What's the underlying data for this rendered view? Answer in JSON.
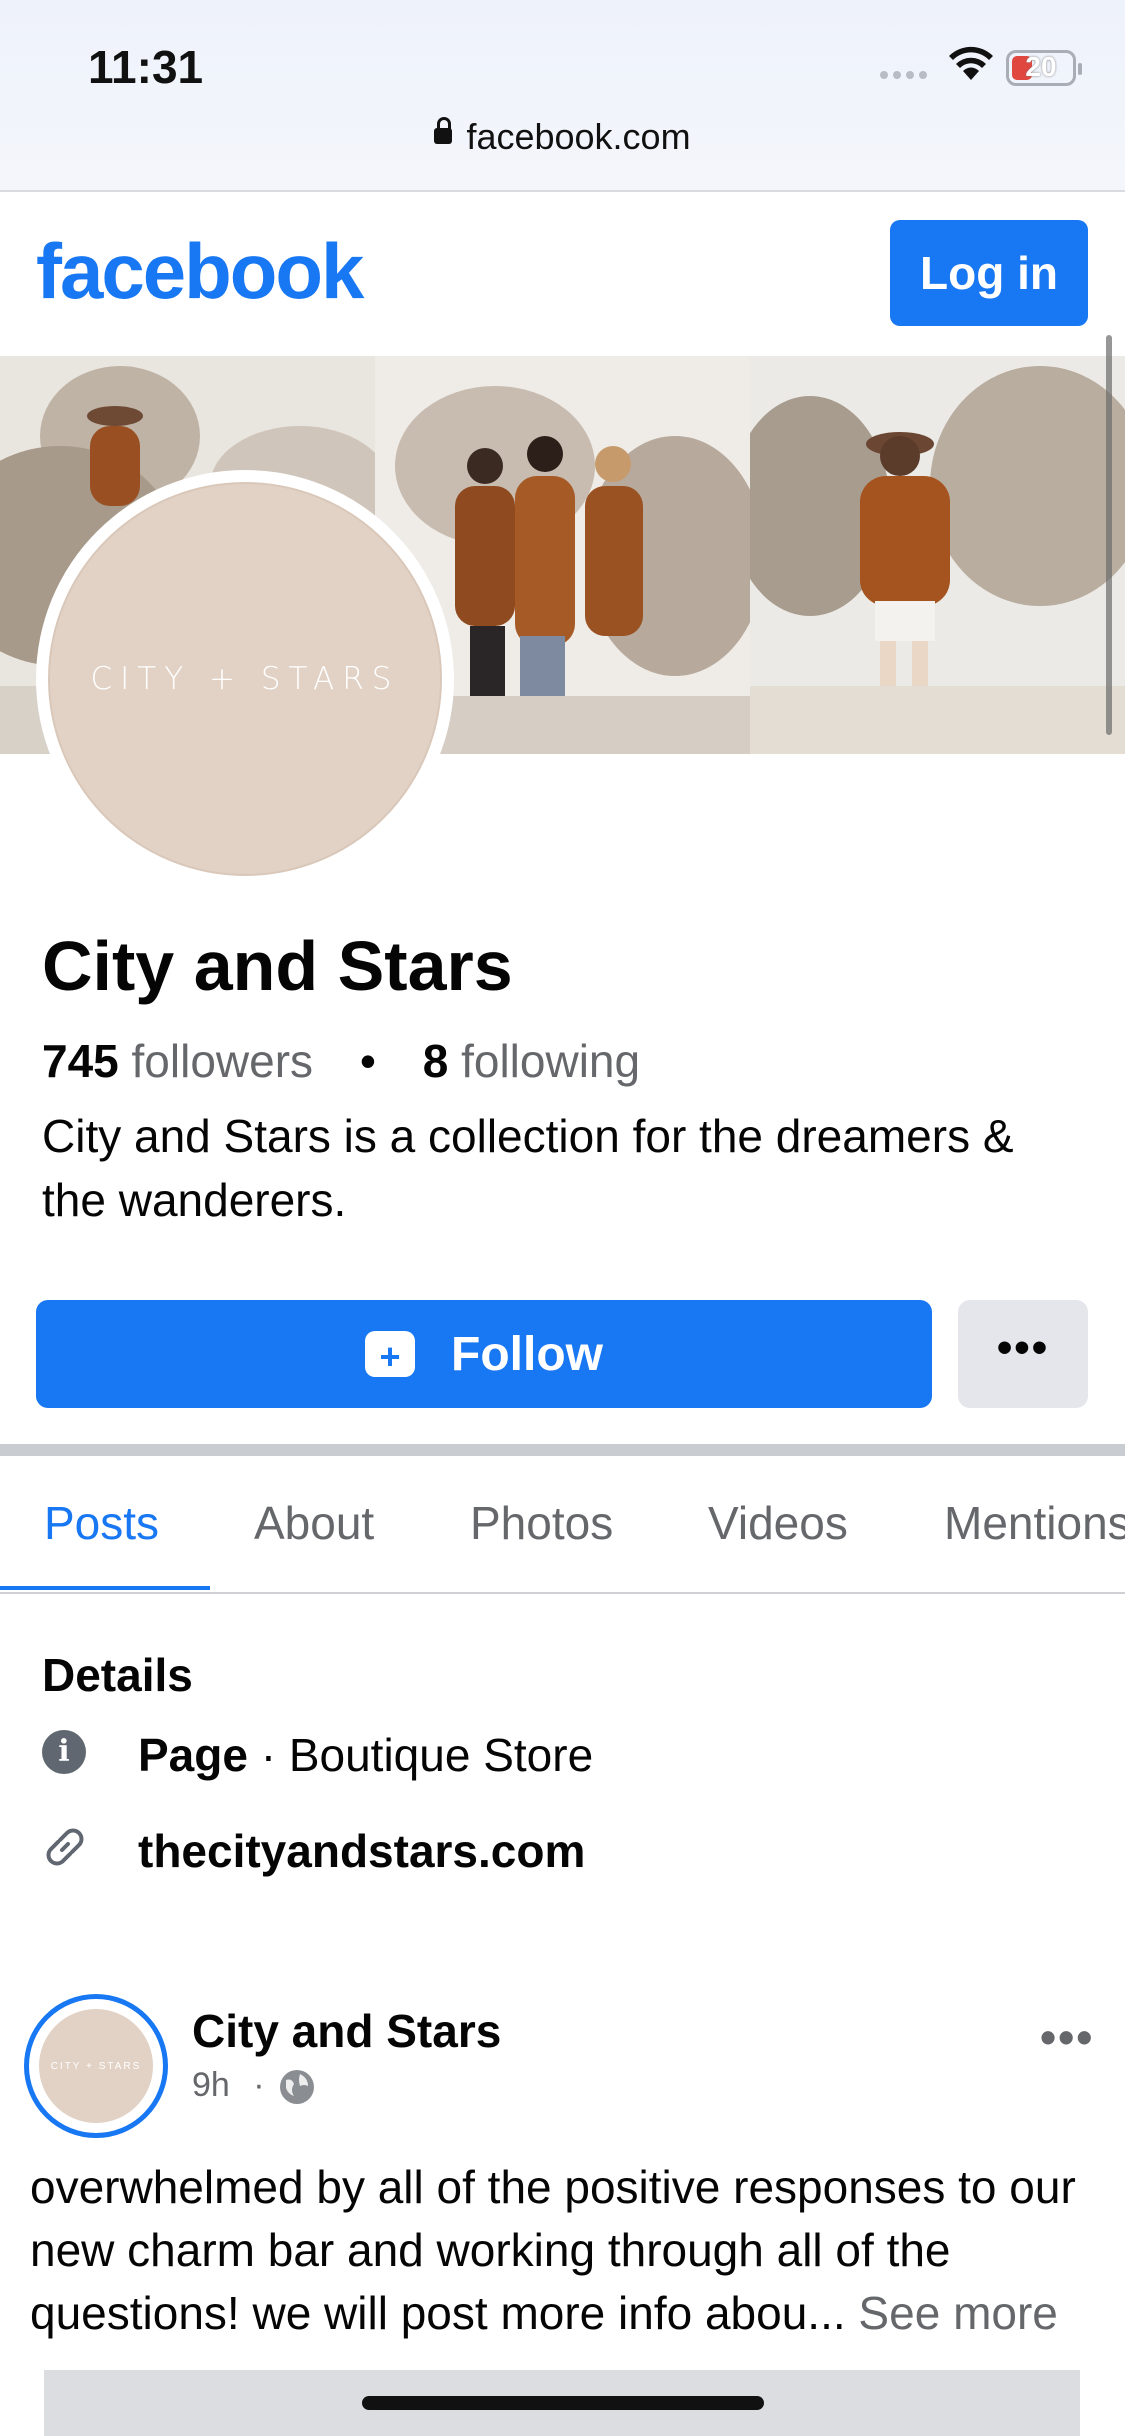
{
  "status_bar": {
    "time": "11:31",
    "battery": "20",
    "url": "facebook.com"
  },
  "header": {
    "logo": "facebook",
    "login_label": "Log in"
  },
  "profile": {
    "avatar_text": "CITY + STARS",
    "name": "City and Stars",
    "followers_count": "745",
    "followers_label": "followers",
    "following_count": "8",
    "following_label": "following",
    "separator": "•",
    "bio": "City and Stars is a collection for the dreamers & the wanderers.",
    "follow_label": "Follow",
    "more_label": "•••"
  },
  "tabs": [
    {
      "label": "Posts",
      "active": true
    },
    {
      "label": "About"
    },
    {
      "label": "Photos"
    },
    {
      "label": "Videos"
    },
    {
      "label": "Mentions"
    }
  ],
  "details": {
    "heading": "Details",
    "type_label": "Page",
    "type_value": " · Boutique Store",
    "website": "thecityandstars.com"
  },
  "post": {
    "author": "City and Stars",
    "time": "9h",
    "dot": "·",
    "text": "overwhelmed by all of the positive responses to our new charm bar and working through all of the questions! we will post more info abou...",
    "see_more": " See more",
    "more_label": "•••",
    "avatar_text": "CITY + STARS"
  },
  "colors": {
    "brand": "#1877f2",
    "secondary_text": "#65676b",
    "avatar_bg": "#e2d2c5"
  }
}
